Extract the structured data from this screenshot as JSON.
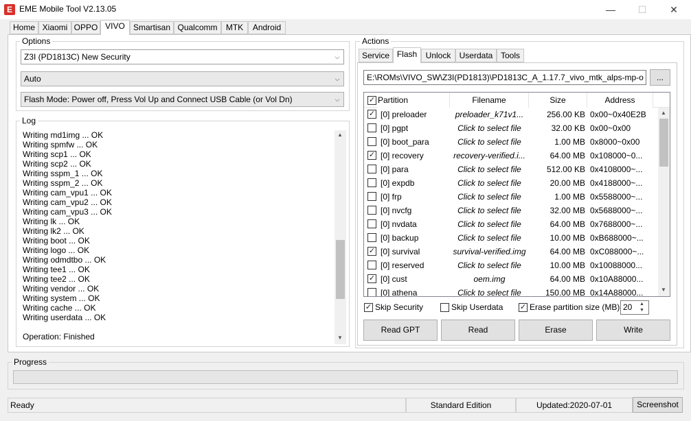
{
  "window": {
    "title": "EME Mobile Tool V2.13.05",
    "icon_letter": "E"
  },
  "top_tabs": [
    "Home",
    "Xiaomi",
    "OPPO",
    "VIVO",
    "Smartisan",
    "Qualcomm",
    "MTK",
    "Android"
  ],
  "top_tab_active": "VIVO",
  "options": {
    "label": "Options",
    "model": "Z3I (PD1813C) New Security",
    "mode": "Auto",
    "flash_mode": "Flash Mode: Power off, Press Vol Up and Connect USB Cable (or Vol Dn)"
  },
  "log": {
    "label": "Log",
    "lines": [
      "Writing md1img ... OK",
      "Writing spmfw ... OK",
      "Writing scp1 ... OK",
      "Writing scp2 ... OK",
      "Writing sspm_1 ... OK",
      "Writing sspm_2 ... OK",
      "Writing cam_vpu1 ... OK",
      "Writing cam_vpu2 ... OK",
      "Writing cam_vpu3 ... OK",
      "Writing lk ... OK",
      "Writing lk2 ... OK",
      "Writing boot ... OK",
      "Writing logo ... OK",
      "Writing odmdtbo ... OK",
      "Writing tee1 ... OK",
      "Writing tee2 ... OK",
      "Writing vendor ... OK",
      "Writing system ... OK",
      "Writing cache ... OK",
      "Writing userdata ... OK"
    ],
    "finished": "Operation: Finished"
  },
  "actions": {
    "label": "Actions",
    "tabs": [
      "Service",
      "Flash",
      "Unlock",
      "Userdata",
      "Tools"
    ],
    "active_tab": "Flash",
    "path": "E:\\ROMs\\VIVO_SW\\Z3I(PD1813)\\PD1813C_A_1.17.7_vivo_mtk_alps-mp-o",
    "browse_label": "...",
    "table": {
      "headers": [
        "Partition",
        "Filename",
        "Size",
        "Address"
      ],
      "rows": [
        {
          "checked": true,
          "partition": "[0] preloader",
          "filename": "preloader_k71v1...",
          "size": "256.00 KB",
          "address": "0x00~0x40E2B"
        },
        {
          "checked": false,
          "partition": "[0] pgpt",
          "filename": "Click to select file",
          "size": "32.00 KB",
          "address": "0x00~0x00"
        },
        {
          "checked": false,
          "partition": "[0] boot_para",
          "filename": "Click to select file",
          "size": "1.00 MB",
          "address": "0x8000~0x00"
        },
        {
          "checked": true,
          "partition": "[0] recovery",
          "filename": "recovery-verified.i...",
          "size": "64.00 MB",
          "address": "0x108000~0..."
        },
        {
          "checked": false,
          "partition": "[0] para",
          "filename": "Click to select file",
          "size": "512.00 KB",
          "address": "0x4108000~..."
        },
        {
          "checked": false,
          "partition": "[0] expdb",
          "filename": "Click to select file",
          "size": "20.00 MB",
          "address": "0x4188000~..."
        },
        {
          "checked": false,
          "partition": "[0] frp",
          "filename": "Click to select file",
          "size": "1.00 MB",
          "address": "0x5588000~..."
        },
        {
          "checked": false,
          "partition": "[0] nvcfg",
          "filename": "Click to select file",
          "size": "32.00 MB",
          "address": "0x5688000~..."
        },
        {
          "checked": false,
          "partition": "[0] nvdata",
          "filename": "Click to select file",
          "size": "64.00 MB",
          "address": "0x7688000~..."
        },
        {
          "checked": false,
          "partition": "[0] backup",
          "filename": "Click to select file",
          "size": "10.00 MB",
          "address": "0xB688000~..."
        },
        {
          "checked": true,
          "partition": "[0] survival",
          "filename": "survival-verified.img",
          "size": "64.00 MB",
          "address": "0xC088000~..."
        },
        {
          "checked": false,
          "partition": "[0] reserved",
          "filename": "Click to select file",
          "size": "10.00 MB",
          "address": "0x10088000..."
        },
        {
          "checked": true,
          "partition": "[0] cust",
          "filename": "oem.img",
          "size": "64.00 MB",
          "address": "0x10A88000..."
        },
        {
          "checked": false,
          "partition": "[0] athena",
          "filename": "Click to select file",
          "size": "150.00 MB",
          "address": "0x14A88000..."
        }
      ]
    },
    "skip_security": "Skip Security",
    "skip_userdata": "Skip Userdata",
    "erase_partition": "Erase partition size (MB)",
    "erase_size": "20",
    "buttons": [
      "Read GPT",
      "Read",
      "Erase",
      "Write"
    ]
  },
  "progress": {
    "label": "Progress",
    "value": 0
  },
  "status": {
    "state": "Ready",
    "edition": "Standard Edition",
    "updated": "Updated:2020-07-01",
    "screenshot": "Screenshot"
  },
  "colors": {
    "app_icon": "#d9302b",
    "panel": "#ffffff",
    "background": "#f0f0f0"
  }
}
